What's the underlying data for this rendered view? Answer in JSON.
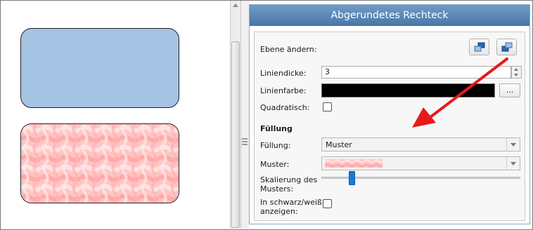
{
  "panel": {
    "title": "Abgerundetes Rechteck",
    "ebene_label": "Ebene ändern:",
    "liniendicke_label": "Liniendicke:",
    "liniendicke_value": "3",
    "linienfarbe_label": "Linienfarbe:",
    "linienfarbe_color": "#000000",
    "color_button_label": "...",
    "quadratisch_label": "Quadratisch:",
    "fuellung_section": "Füllung",
    "fuellung_label": "Füllung:",
    "fuellung_value": "Muster",
    "muster_label": "Muster:",
    "skalierung_label_1": "Skalierung des",
    "skalierung_label_2": "Musters:",
    "skalierung_value": 0.14,
    "sw_label_1": "In schwarz/weiß",
    "sw_label_2": "anzeigen:"
  },
  "canvas": {
    "shape1_fill": "#a5c3e3",
    "shape2_fill": "#ffc6c6"
  },
  "icons": {
    "layer_back": "bring-backward-icon",
    "layer_front": "bring-forward-icon"
  },
  "accent_colors": {
    "title_bar": "#5585b6",
    "slider": "#1a7ad8",
    "annotation_arrow": "#e8191b"
  }
}
